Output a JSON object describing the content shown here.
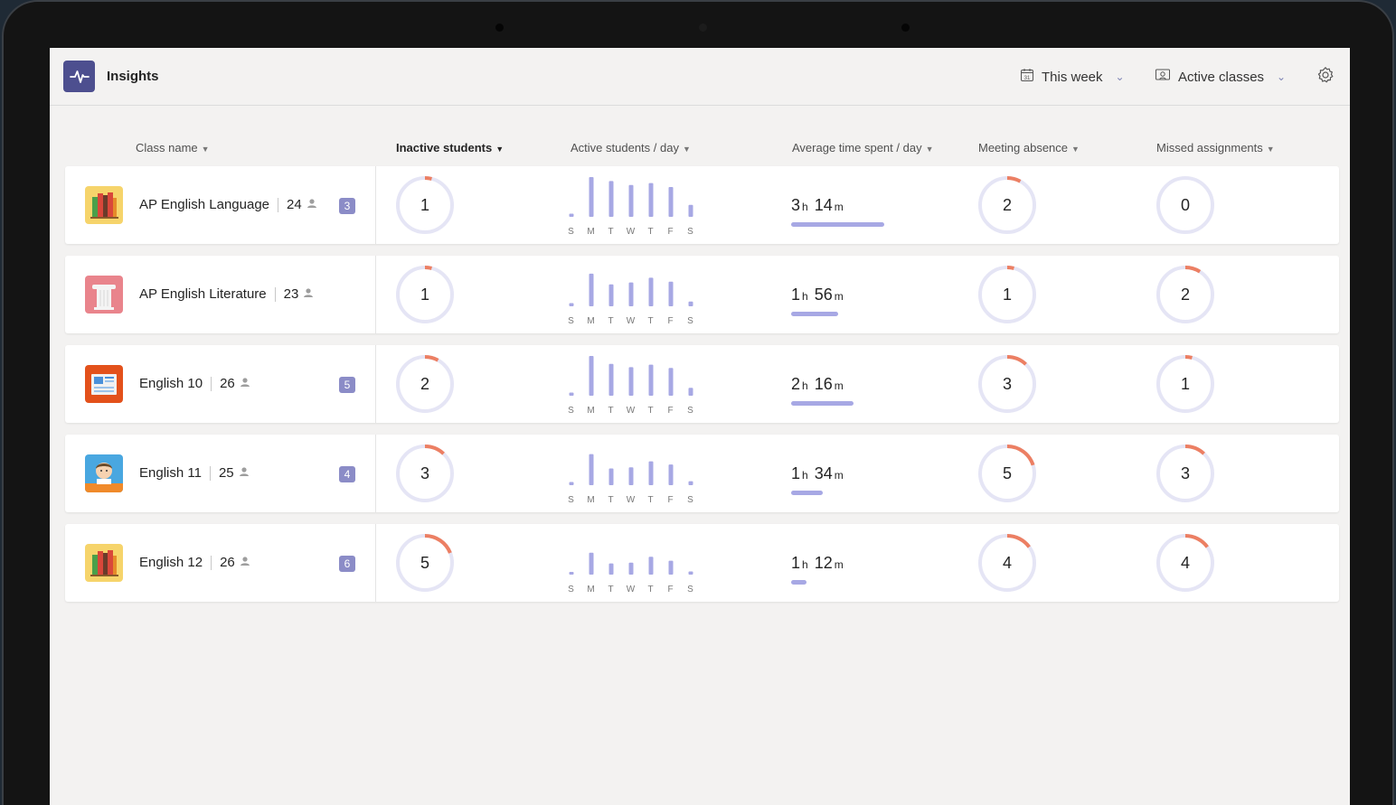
{
  "app": {
    "title": "Insights",
    "icon": "pulse-icon",
    "accent": "#4d4f8f"
  },
  "filters": {
    "time": {
      "label": "This week",
      "icon": "calendar-icon"
    },
    "classes": {
      "label": "Active classes",
      "icon": "classroom-icon"
    },
    "settings_icon": "gear-icon"
  },
  "columns": {
    "class_name": "Class name",
    "inactive": "Inactive students",
    "active_day": "Active students / day",
    "avg_time": "Average time spent / day",
    "absence": "Meeting absence",
    "missed": "Missed assignments"
  },
  "day_labels": [
    "S",
    "M",
    "T",
    "W",
    "T",
    "F",
    "S"
  ],
  "colors": {
    "ring_track": "#e5e5f5",
    "ring_alert": "#ec7f63",
    "bar": "#a7a8e4",
    "badge": "#8b8cc7"
  },
  "rows": [
    {
      "name": "AP English Language",
      "students": "24",
      "badge": "3",
      "thumb": "books",
      "inactive": "1",
      "inactive_frac": 0.04,
      "daily": [
        0.08,
        1.0,
        0.9,
        0.8,
        0.85,
        0.75,
        0.3
      ],
      "hours": "3",
      "minutes": "14",
      "time_frac": 0.97,
      "absence": "2",
      "absence_frac": 0.08,
      "missed": "0",
      "missed_frac": 0.0
    },
    {
      "name": "AP English Literature",
      "students": "23",
      "badge": "",
      "thumb": "column",
      "inactive": "1",
      "inactive_frac": 0.04,
      "daily": [
        0.08,
        0.82,
        0.55,
        0.6,
        0.72,
        0.62,
        0.12
      ],
      "hours": "1",
      "minutes": "56",
      "time_frac": 0.49,
      "absence": "1",
      "absence_frac": 0.04,
      "missed": "2",
      "missed_frac": 0.09
    },
    {
      "name": "English 10",
      "students": "26",
      "badge": "5",
      "thumb": "newspaper",
      "inactive": "2",
      "inactive_frac": 0.08,
      "daily": [
        0.08,
        1.0,
        0.8,
        0.72,
        0.78,
        0.7,
        0.2
      ],
      "hours": "2",
      "minutes": "16",
      "time_frac": 0.65,
      "absence": "3",
      "absence_frac": 0.12,
      "missed": "1",
      "missed_frac": 0.04
    },
    {
      "name": "English 11",
      "students": "25",
      "badge": "4",
      "thumb": "shakespeare",
      "inactive": "3",
      "inactive_frac": 0.12,
      "daily": [
        0.08,
        0.78,
        0.42,
        0.45,
        0.6,
        0.52,
        0.1
      ],
      "hours": "1",
      "minutes": "34",
      "time_frac": 0.33,
      "absence": "5",
      "absence_frac": 0.2,
      "missed": "3",
      "missed_frac": 0.12
    },
    {
      "name": "English 12",
      "students": "26",
      "badge": "6",
      "thumb": "books",
      "inactive": "5",
      "inactive_frac": 0.19,
      "daily": [
        0.06,
        0.55,
        0.28,
        0.3,
        0.45,
        0.35,
        0.08
      ],
      "hours": "1",
      "minutes": "12",
      "time_frac": 0.16,
      "absence": "4",
      "absence_frac": 0.15,
      "missed": "4",
      "missed_frac": 0.15
    }
  ]
}
